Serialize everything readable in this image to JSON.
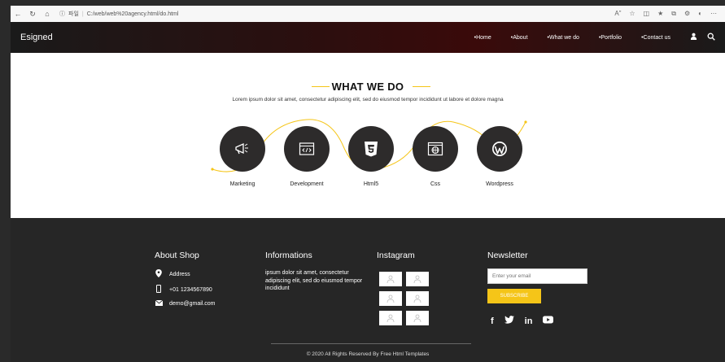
{
  "browser": {
    "url_label": "파일",
    "url": "C:/web/web%20agency.html/do.html"
  },
  "header": {
    "brand": "Esigned",
    "nav": [
      "Home",
      "About",
      "What we do",
      "Portfolio",
      "Contact us"
    ]
  },
  "section": {
    "title": "WHAT WE DO",
    "subtitle": "Lorem ipsum dolor sit amet, consectetur adipiscing elit, sed do eiusmod tempor incididunt ut labore et dolore magna",
    "accent_color": "#f5c518",
    "services": [
      {
        "label": "Marketing",
        "icon": "megaphone-icon"
      },
      {
        "label": "Development",
        "icon": "code-window-icon"
      },
      {
        "label": "Html5",
        "icon": "html5-icon"
      },
      {
        "label": "Css",
        "icon": "browser-globe-icon"
      },
      {
        "label": "Wordpress",
        "icon": "wordpress-icon"
      }
    ]
  },
  "footer": {
    "about_title": "About Shop",
    "address": "Address",
    "phone": "+01 1234567890",
    "email": "demo@gmail.com",
    "info_title": "Informations",
    "info_text": "ipsum dolor sit amet, consectetur adipiscing elit, sed do eiusmod tempor incididunt",
    "instagram_title": "Instagram",
    "newsletter_title": "Newsletter",
    "email_placeholder": "Enter your email",
    "subscribe_label": "SUBSCRIBE",
    "copyright": "© 2020 All Rights Reserved By Free Html Templates"
  }
}
